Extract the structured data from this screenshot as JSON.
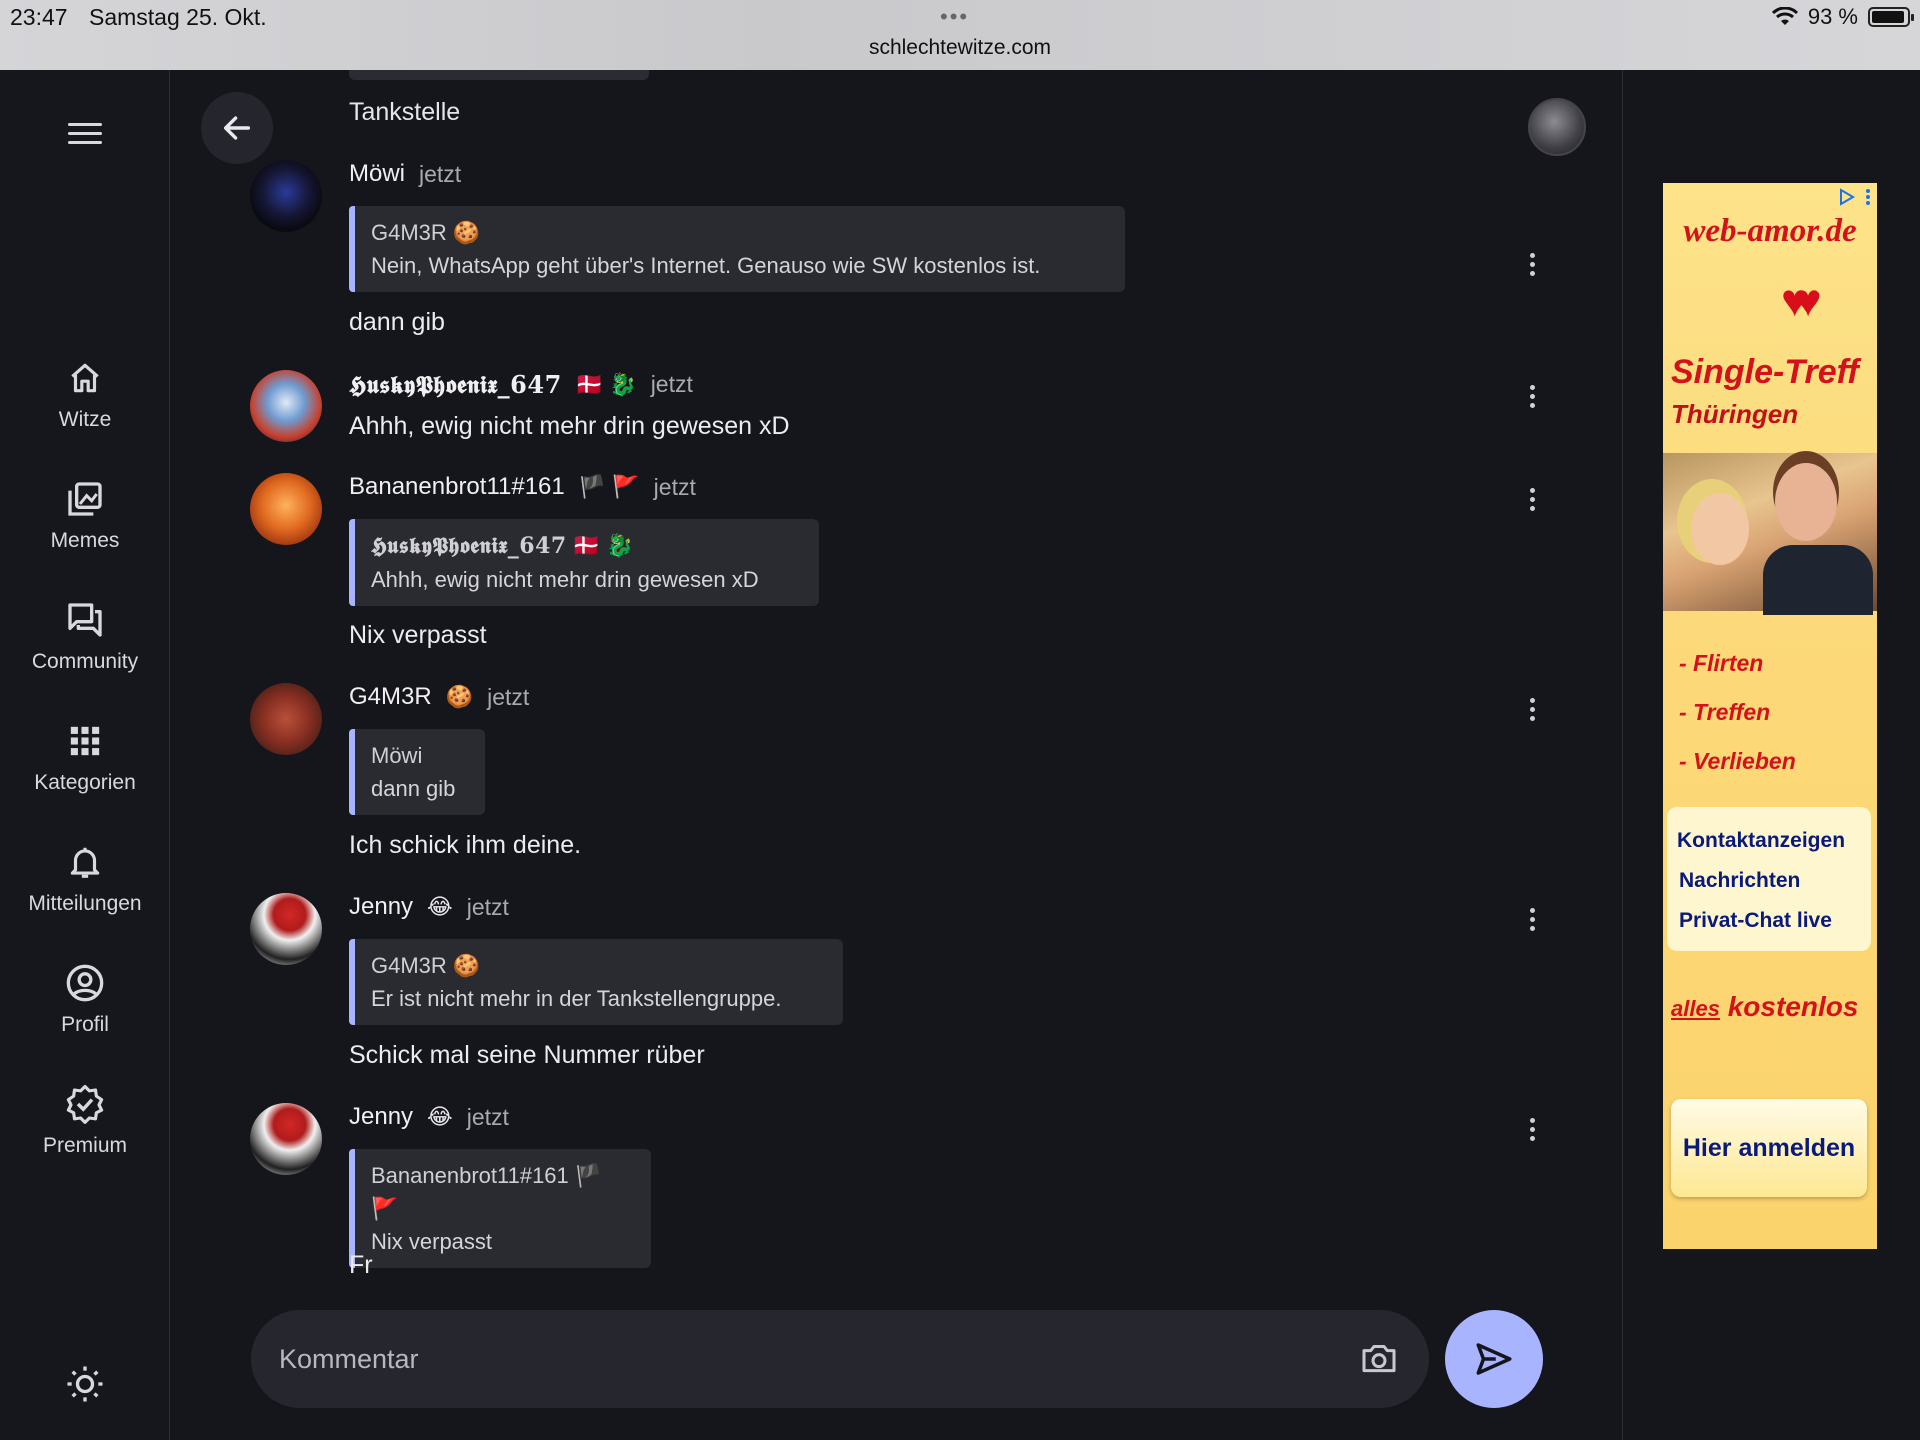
{
  "status_bar": {
    "time": "23:47",
    "date": "Samstag 25. Okt.",
    "url": "schlechtewitze.com",
    "battery": "93 %",
    "battery_level": 0.93
  },
  "sidebar": {
    "items": [
      {
        "label": "Witze",
        "icon": "home-icon"
      },
      {
        "label": "Memes",
        "icon": "images-icon"
      },
      {
        "label": "Community",
        "icon": "forum-icon"
      },
      {
        "label": "Kategorien",
        "icon": "grid-icon"
      },
      {
        "label": "Mitteilungen",
        "icon": "bell-icon"
      },
      {
        "label": "Profil",
        "icon": "account-circle-icon"
      },
      {
        "label": "Premium",
        "icon": "verified-badge-icon"
      }
    ]
  },
  "chat": {
    "previous_text": "Tankstelle",
    "messages": [
      {
        "author": "Möwi",
        "author_emoji": "",
        "time": "jetzt",
        "quote": {
          "author": "G4M3R",
          "author_emoji": "🍪",
          "text": "Nein, WhatsApp geht über's Internet. Genauso wie SW kostenlos ist."
        },
        "text": "dann gib"
      },
      {
        "author": "𝕳𝖚𝖘𝖐𝖞𝕻𝖍𝖔𝖊𝖓𝖎𝖝_647",
        "author_emoji": "🇩🇰 🐉",
        "time": "jetzt",
        "quote": null,
        "text": "Ahhh, ewig nicht mehr drin gewesen xD"
      },
      {
        "author": "Bananenbrot11#161",
        "author_emoji": "🏴 🚩",
        "time": "jetzt",
        "quote": {
          "author": "𝕳𝖚𝖘𝖐𝖞𝕻𝖍𝖔𝖊𝖓𝖎𝖝_647",
          "author_emoji": "🇩🇰 🐉",
          "text": "Ahhh, ewig nicht mehr drin gewesen xD"
        },
        "text": "Nix verpasst"
      },
      {
        "author": "G4M3R",
        "author_emoji": "🍪",
        "time": "jetzt",
        "quote": {
          "author": "Möwi",
          "author_emoji": "",
          "text": "dann gib"
        },
        "text": "Ich schick ihm deine."
      },
      {
        "author": "Jenny",
        "author_emoji": "😂",
        "time": "jetzt",
        "quote": {
          "author": "G4M3R",
          "author_emoji": "🍪",
          "text": "Er ist nicht mehr in der Tankstellengruppe."
        },
        "text": "Schick mal seine Nummer rüber"
      },
      {
        "author": "Jenny",
        "author_emoji": "😂",
        "time": "jetzt",
        "quote": {
          "author": "Bananenbrot11#161",
          "author_emoji": "🏴 🚩",
          "text": "Nix verpasst"
        },
        "text": "Fr"
      }
    ]
  },
  "composer": {
    "placeholder": "Kommentar"
  },
  "ad": {
    "brand": "web-amor.de",
    "title": "Single-Treff",
    "subtitle": "Thüringen",
    "bullets": [
      "- Flirten",
      "- Treffen",
      "- Verlieben"
    ],
    "features": [
      "Kontaktanzeigen",
      "Nachrichten",
      "Privat-Chat live"
    ],
    "free_prefix": "alles",
    "free_word": "kostenlos",
    "cta": "Hier anmelden"
  },
  "colors": {
    "accent": "#a9b4ff",
    "background": "#15151c",
    "surface": "#26262e",
    "ad_red": "#d3121b",
    "ad_blue": "#0a1a7a"
  }
}
